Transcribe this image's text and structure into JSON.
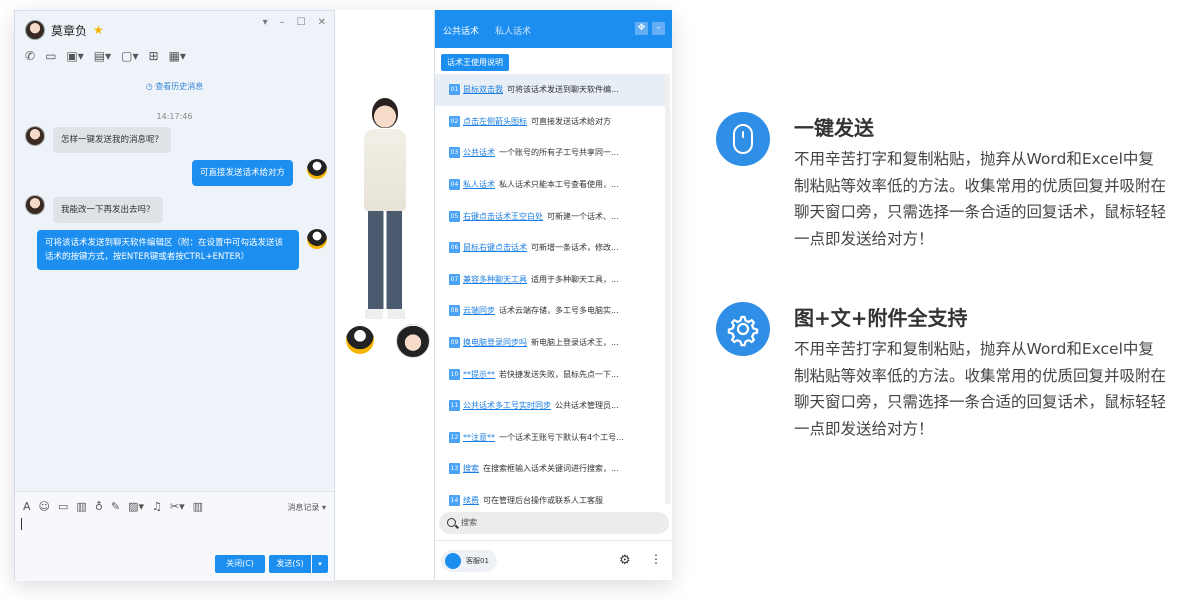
{
  "chat": {
    "contact_name": "莫章负",
    "history_link": "查看历史消息",
    "timestamp": "14:17:46",
    "messages": [
      {
        "from": "in",
        "text": "怎样一键发送我的消息呢？"
      },
      {
        "from": "out",
        "text": "可直接发送话术给对方"
      },
      {
        "from": "in",
        "text": "我能改一下再发出去吗？"
      },
      {
        "from": "out",
        "text": "可将该话术发送到聊天软件编辑区（附：在设置中可勾选发送该话术的按键方式，按ENTER键或者按CTRL+ENTER）"
      }
    ],
    "msg_record": "消息记录",
    "close_button": "关闭(C)",
    "send_button": "发送(S)"
  },
  "panel": {
    "tab_public": "公共话术",
    "tab_private": "私人话术",
    "usage_button": "话术王使用说明",
    "items": [
      {
        "num": "01",
        "kw": "鼠标双击我",
        "desc": "可将该话术发送到聊天软件编..."
      },
      {
        "num": "02",
        "kw": "点击左侧箭头图标",
        "desc": "可直接发送话术给对方"
      },
      {
        "num": "03",
        "kw": "公共话术",
        "desc": "一个账号的所有子工号共享同一..."
      },
      {
        "num": "04",
        "kw": "私人话术",
        "desc": "私人话术只能本工号查看使用，..."
      },
      {
        "num": "05",
        "kw": "右键点击话术王空白处",
        "desc": "可新建一个话术、..."
      },
      {
        "num": "06",
        "kw": "鼠标右键点击话术",
        "desc": "可新增一条话术，修改..."
      },
      {
        "num": "07",
        "kw": "兼容多种聊天工具",
        "desc": "适用于多种聊天工具，..."
      },
      {
        "num": "08",
        "kw": "云端同步",
        "desc": "话术云端存储，多工号多电脑实..."
      },
      {
        "num": "09",
        "kw": "换电脑登录同步吗",
        "desc": "新电脑上登录话术王，..."
      },
      {
        "num": "10",
        "kw": "**提示**",
        "desc": "若快捷发送失败，鼠标先点一下..."
      },
      {
        "num": "11",
        "kw": "公共话术多工号实时同步",
        "desc": "公共话术管理员..."
      },
      {
        "num": "12",
        "kw": "**注意**",
        "desc": "一个话术王账号下默认有4个工号..."
      },
      {
        "num": "13",
        "kw": "搜索",
        "desc": "在搜索框输入话术关键词进行搜索，..."
      },
      {
        "num": "14",
        "kw": "续费",
        "desc": "可在管理后台操作或联系人工客服"
      }
    ],
    "search_placeholder": "搜索",
    "agent_name": "客服01"
  },
  "features": [
    {
      "icon": "mouse-icon",
      "title": "一键发送",
      "desc": "不用辛苦打字和复制粘贴，抛弃从Word和Excel中复制粘贴等效率低的方法。收集常用的优质回复并吸附在聊天窗口旁，只需选择一条合适的回复话术，鼠标轻轻一点即发送给对方！"
    },
    {
      "icon": "gear-icon",
      "title": "图+文+附件全支持",
      "desc": "不用辛苦打字和复制粘贴，抛弃从Word和Excel中复制粘贴等效率低的方法。收集常用的优质回复并吸附在聊天窗口旁，只需选择一条合适的回复话术，鼠标轻轻一点即发送给对方！"
    }
  ],
  "colors": {
    "accent": "#1c8ef0",
    "feature_icon": "#2f8ee5"
  }
}
